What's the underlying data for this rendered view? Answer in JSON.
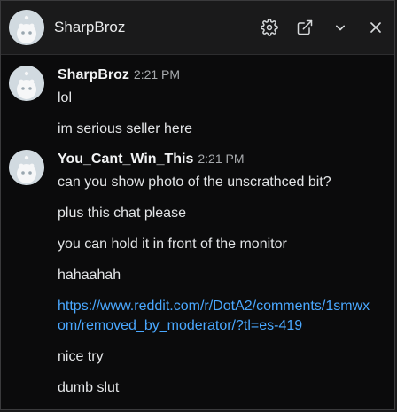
{
  "header": {
    "title": "SharpBroz",
    "actions": [
      "gear-icon",
      "open-external-icon",
      "chevron-down-icon",
      "close-icon"
    ]
  },
  "messages": [
    {
      "username": "SharpBroz",
      "time": "2:21 PM",
      "lines": [
        "lol",
        "im serious seller here"
      ]
    },
    {
      "username": "You_Cant_Win_This",
      "time": "2:21 PM",
      "lines": [
        "can you show photo of the unscrathced bit?",
        "plus this chat please",
        "you can hold it in front of the monitor",
        "hahaahah",
        "https://www.reddit.com/r/DotA2/comments/1smwxom/removed_by_moderator/?tl=es-419",
        "nice try",
        "dumb slut"
      ]
    }
  ],
  "colors": {
    "background": "#0b0b0c",
    "header_background": "#1a1a1b",
    "link": "#4aa8ff",
    "text": "#e3e5e7",
    "timestamp": "#a7aaad"
  }
}
